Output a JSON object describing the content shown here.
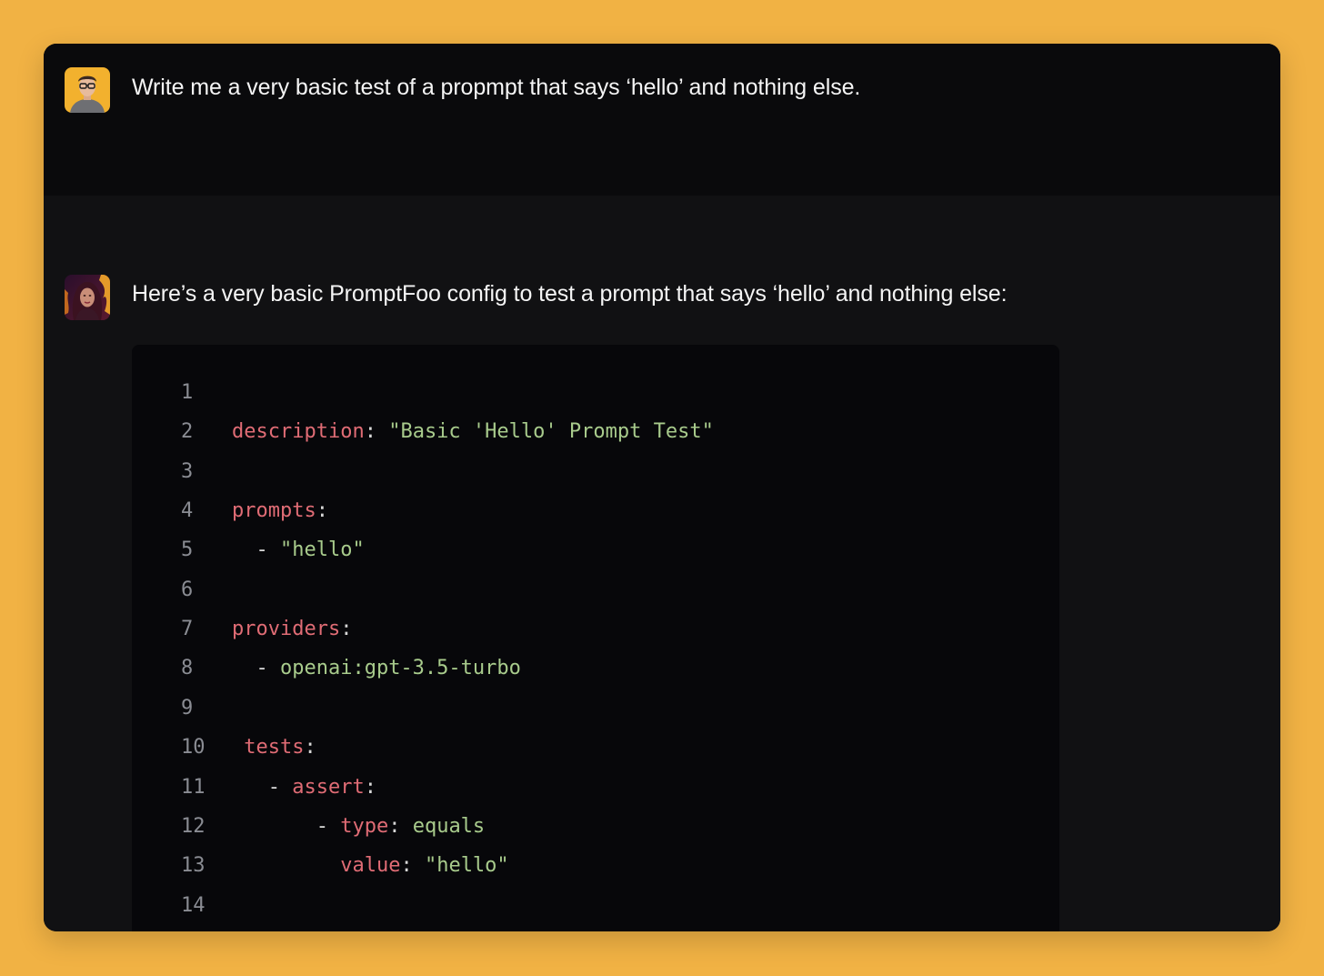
{
  "conversation": {
    "user_message": {
      "avatar": "user-avatar",
      "text": "Write me a very basic test of a propmpt that says ‘hello’ and nothing else."
    },
    "assistant_message": {
      "avatar": "assistant-avatar",
      "text": "Here’s a very basic PromptFoo config to test a prompt that says ‘hello’ and nothing else:",
      "code_block": {
        "lines": [
          {
            "num": "1",
            "segments": []
          },
          {
            "num": "2",
            "segments": [
              {
                "text": "description",
                "kind": "key"
              },
              {
                "text": ": ",
                "kind": "punc"
              },
              {
                "text": "\"Basic 'Hello' Prompt Test\"",
                "kind": "str"
              }
            ]
          },
          {
            "num": "3",
            "segments": []
          },
          {
            "num": "4",
            "segments": [
              {
                "text": "prompts",
                "kind": "key"
              },
              {
                "text": ":",
                "kind": "punc"
              }
            ]
          },
          {
            "num": "5",
            "segments": [
              {
                "text": "  - ",
                "kind": "punc"
              },
              {
                "text": "\"hello\"",
                "kind": "str"
              }
            ]
          },
          {
            "num": "6",
            "segments": []
          },
          {
            "num": "7",
            "segments": [
              {
                "text": "providers",
                "kind": "key"
              },
              {
                "text": ":",
                "kind": "punc"
              }
            ]
          },
          {
            "num": "8",
            "segments": [
              {
                "text": "  - ",
                "kind": "punc"
              },
              {
                "text": "openai:gpt-3.5-turbo",
                "kind": "plain"
              }
            ]
          },
          {
            "num": "9",
            "segments": []
          },
          {
            "num": "10",
            "segments": [
              {
                "text": " tests",
                "kind": "key"
              },
              {
                "text": ":",
                "kind": "punc"
              }
            ]
          },
          {
            "num": "11",
            "segments": [
              {
                "text": "   - ",
                "kind": "punc"
              },
              {
                "text": "assert",
                "kind": "key"
              },
              {
                "text": ":",
                "kind": "punc"
              }
            ]
          },
          {
            "num": "12",
            "segments": [
              {
                "text": "       - ",
                "kind": "punc"
              },
              {
                "text": "type",
                "kind": "key"
              },
              {
                "text": ": ",
                "kind": "punc"
              },
              {
                "text": "equals",
                "kind": "plain"
              }
            ]
          },
          {
            "num": "13",
            "segments": [
              {
                "text": "         ",
                "kind": "punc"
              },
              {
                "text": "value",
                "kind": "key"
              },
              {
                "text": ": ",
                "kind": "punc"
              },
              {
                "text": "\"hello\"",
                "kind": "str"
              }
            ]
          },
          {
            "num": "14",
            "segments": []
          }
        ]
      }
    }
  },
  "colors": {
    "background": "#F1B244",
    "window": "#111113",
    "user_row": "#0A0A0C",
    "code_bg": "#07070A",
    "key": "#E06C75",
    "string": "#A8CB8C",
    "line_number": "#8A8C93"
  }
}
